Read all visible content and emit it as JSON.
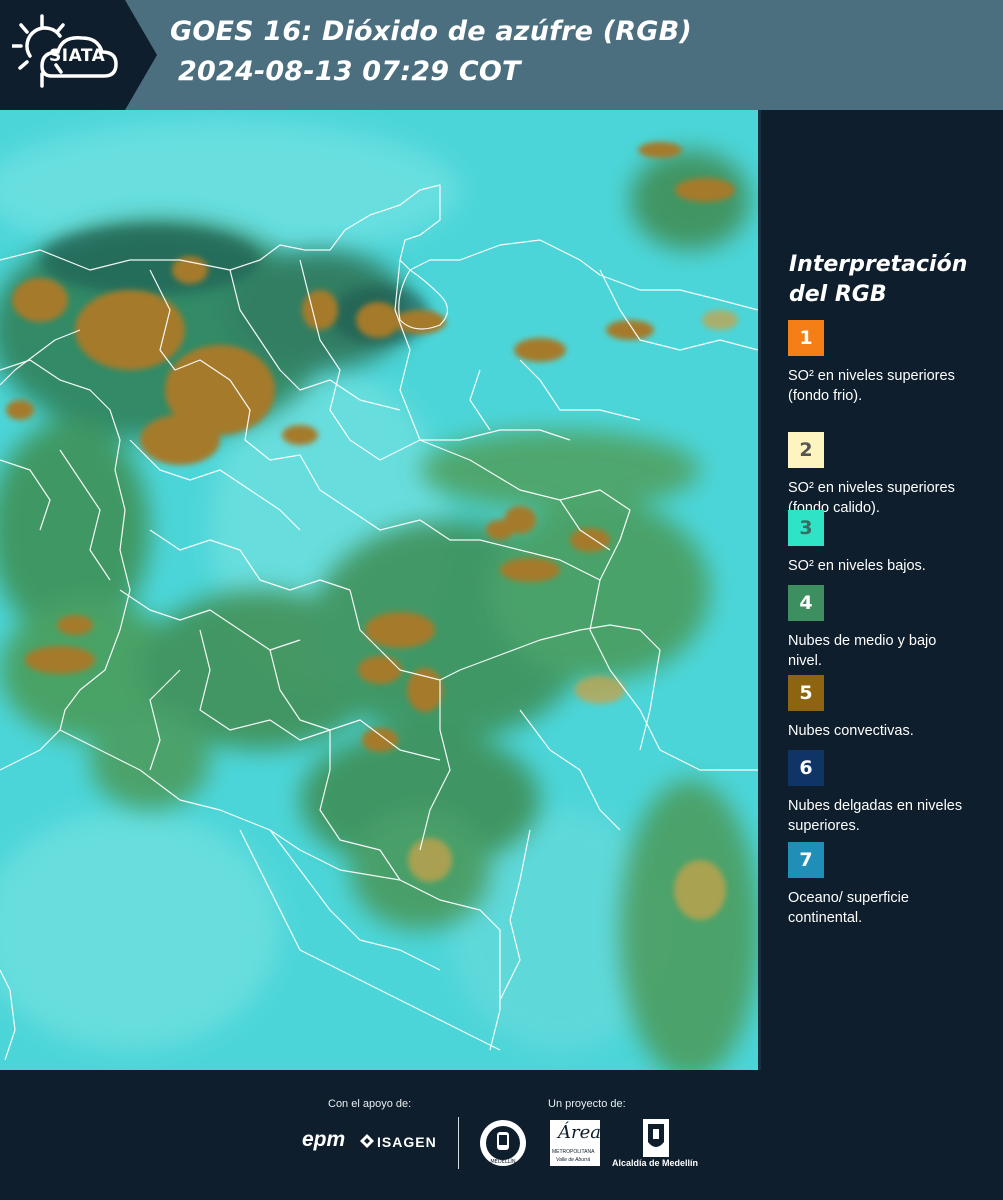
{
  "header": {
    "logo_text": "SIATA",
    "title_line1": "GOES 16: Dióxido de azúfre (RGB)",
    "title_line2": "2024-08-13 07:29 COT"
  },
  "colors": {
    "header_bg": "#4c6f7f",
    "panel_bg": "#0e1e2c",
    "ocean_cyan": "#4cd5d8",
    "cloud_green": "#3f8a52",
    "convective_brown": "#a97e28",
    "borders": "#ffffff"
  },
  "legend": {
    "title": "Interpretación del RGB",
    "items": [
      {
        "number": "1",
        "text": "SO² en niveles superiores (fondo frio).",
        "color": "#f57f17",
        "num_color": "#ffffff"
      },
      {
        "number": "2",
        "text": "SO² en niveles superiores (fondo calido).",
        "color": "#fdf4c0",
        "num_color": "#555555"
      },
      {
        "number": "3",
        "text": "SO² en niveles bajos.",
        "color": "#2fe3c6",
        "num_color": "#3a6a60"
      },
      {
        "number": "4",
        "text": "Nubes de medio y bajo nivel.",
        "color": "#3d8f5f",
        "num_color": "#ffffff"
      },
      {
        "number": "5",
        "text": "Nubes convectivas.",
        "color": "#8d6510",
        "num_color": "#ffffff"
      },
      {
        "number": "6",
        "text": "Nubes delgadas en niveles superiores.",
        "color": "#0f3566",
        "num_color": "#ffffff"
      },
      {
        "number": "7",
        "text": "Oceano/ superficie continental.",
        "color": "#1f8fb8",
        "num_color": "#ffffff"
      }
    ]
  },
  "footer": {
    "support_label": "Con el apoyo de:",
    "project_label": "Un proyecto de:",
    "sponsor_1": "epm",
    "sponsor_2": "ISAGEN",
    "partner_1": "Medellín",
    "partner_2_name": "Área",
    "partner_2_sub": "METROPOLITANA",
    "partner_2_sub2": "Valle de Aburrá",
    "partner_3": "Alcaldía de Medellín"
  }
}
